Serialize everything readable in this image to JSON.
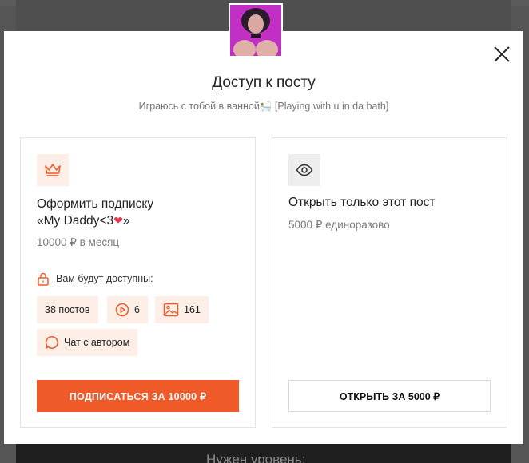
{
  "modal": {
    "title": "Доступ к посту",
    "subtitle": "Играюсь с тобой в ванной🛀 [Playing with u in da bath]",
    "close_icon": "close-icon"
  },
  "subscription": {
    "icon": "crown-icon",
    "title_line1": "Оформить подписку",
    "title_line2_prefix": "«My Daddy<3",
    "title_heart": "❤",
    "title_line2_suffix": "»",
    "price": "10000 ₽ в месяц",
    "available_label": "Вам будут доступны:",
    "chips": [
      {
        "label": "38 постов",
        "icon": ""
      },
      {
        "label": "6",
        "icon": "video-play-icon"
      },
      {
        "label": "161",
        "icon": "image-icon"
      },
      {
        "label": "Чат с автором",
        "icon": "chat-icon"
      }
    ],
    "button_label": "ПОДПИСАТЬСЯ ЗА 10000 ₽"
  },
  "single_post": {
    "icon": "eye-icon",
    "title": "Открыть только этот пост",
    "price": "5000 ₽ единоразово",
    "button_label": "ОТКРЫТЬ ЗА 5000 ₽"
  },
  "background": {
    "hint": "Нужен уровень:"
  },
  "colors": {
    "accent": "#f05a28",
    "chip_bg": "#fdeee7",
    "overlay": "#555555"
  }
}
